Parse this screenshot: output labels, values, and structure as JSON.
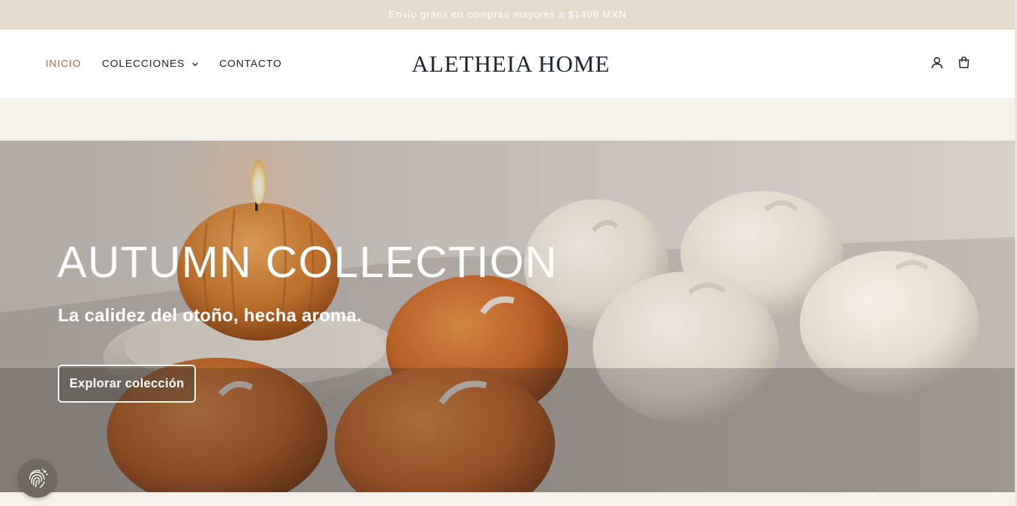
{
  "announcement": {
    "text": "Envío gratis en compras mayores a $1499 MXN"
  },
  "header": {
    "nav": [
      {
        "label": "INICIO",
        "active": true
      },
      {
        "label": "COLECCIONES",
        "has_dropdown": true
      },
      {
        "label": "CONTACTO"
      }
    ],
    "logo": "ALETHEIA HOME",
    "icons": [
      "account-icon",
      "cart-icon"
    ]
  },
  "hero": {
    "title": "AUTUMN COLLECTION",
    "subtitle": "La calidez del otoño, hecha aroma.",
    "button_label": "Explorar colección"
  },
  "colors": {
    "announcement_bg": "#e3dccd",
    "nav_active": "#a86a47",
    "logo": "#1f2433",
    "page_bg": "#f4f0ec"
  },
  "widgets": {
    "privacy_badge_icon": "fingerprint-icon"
  }
}
